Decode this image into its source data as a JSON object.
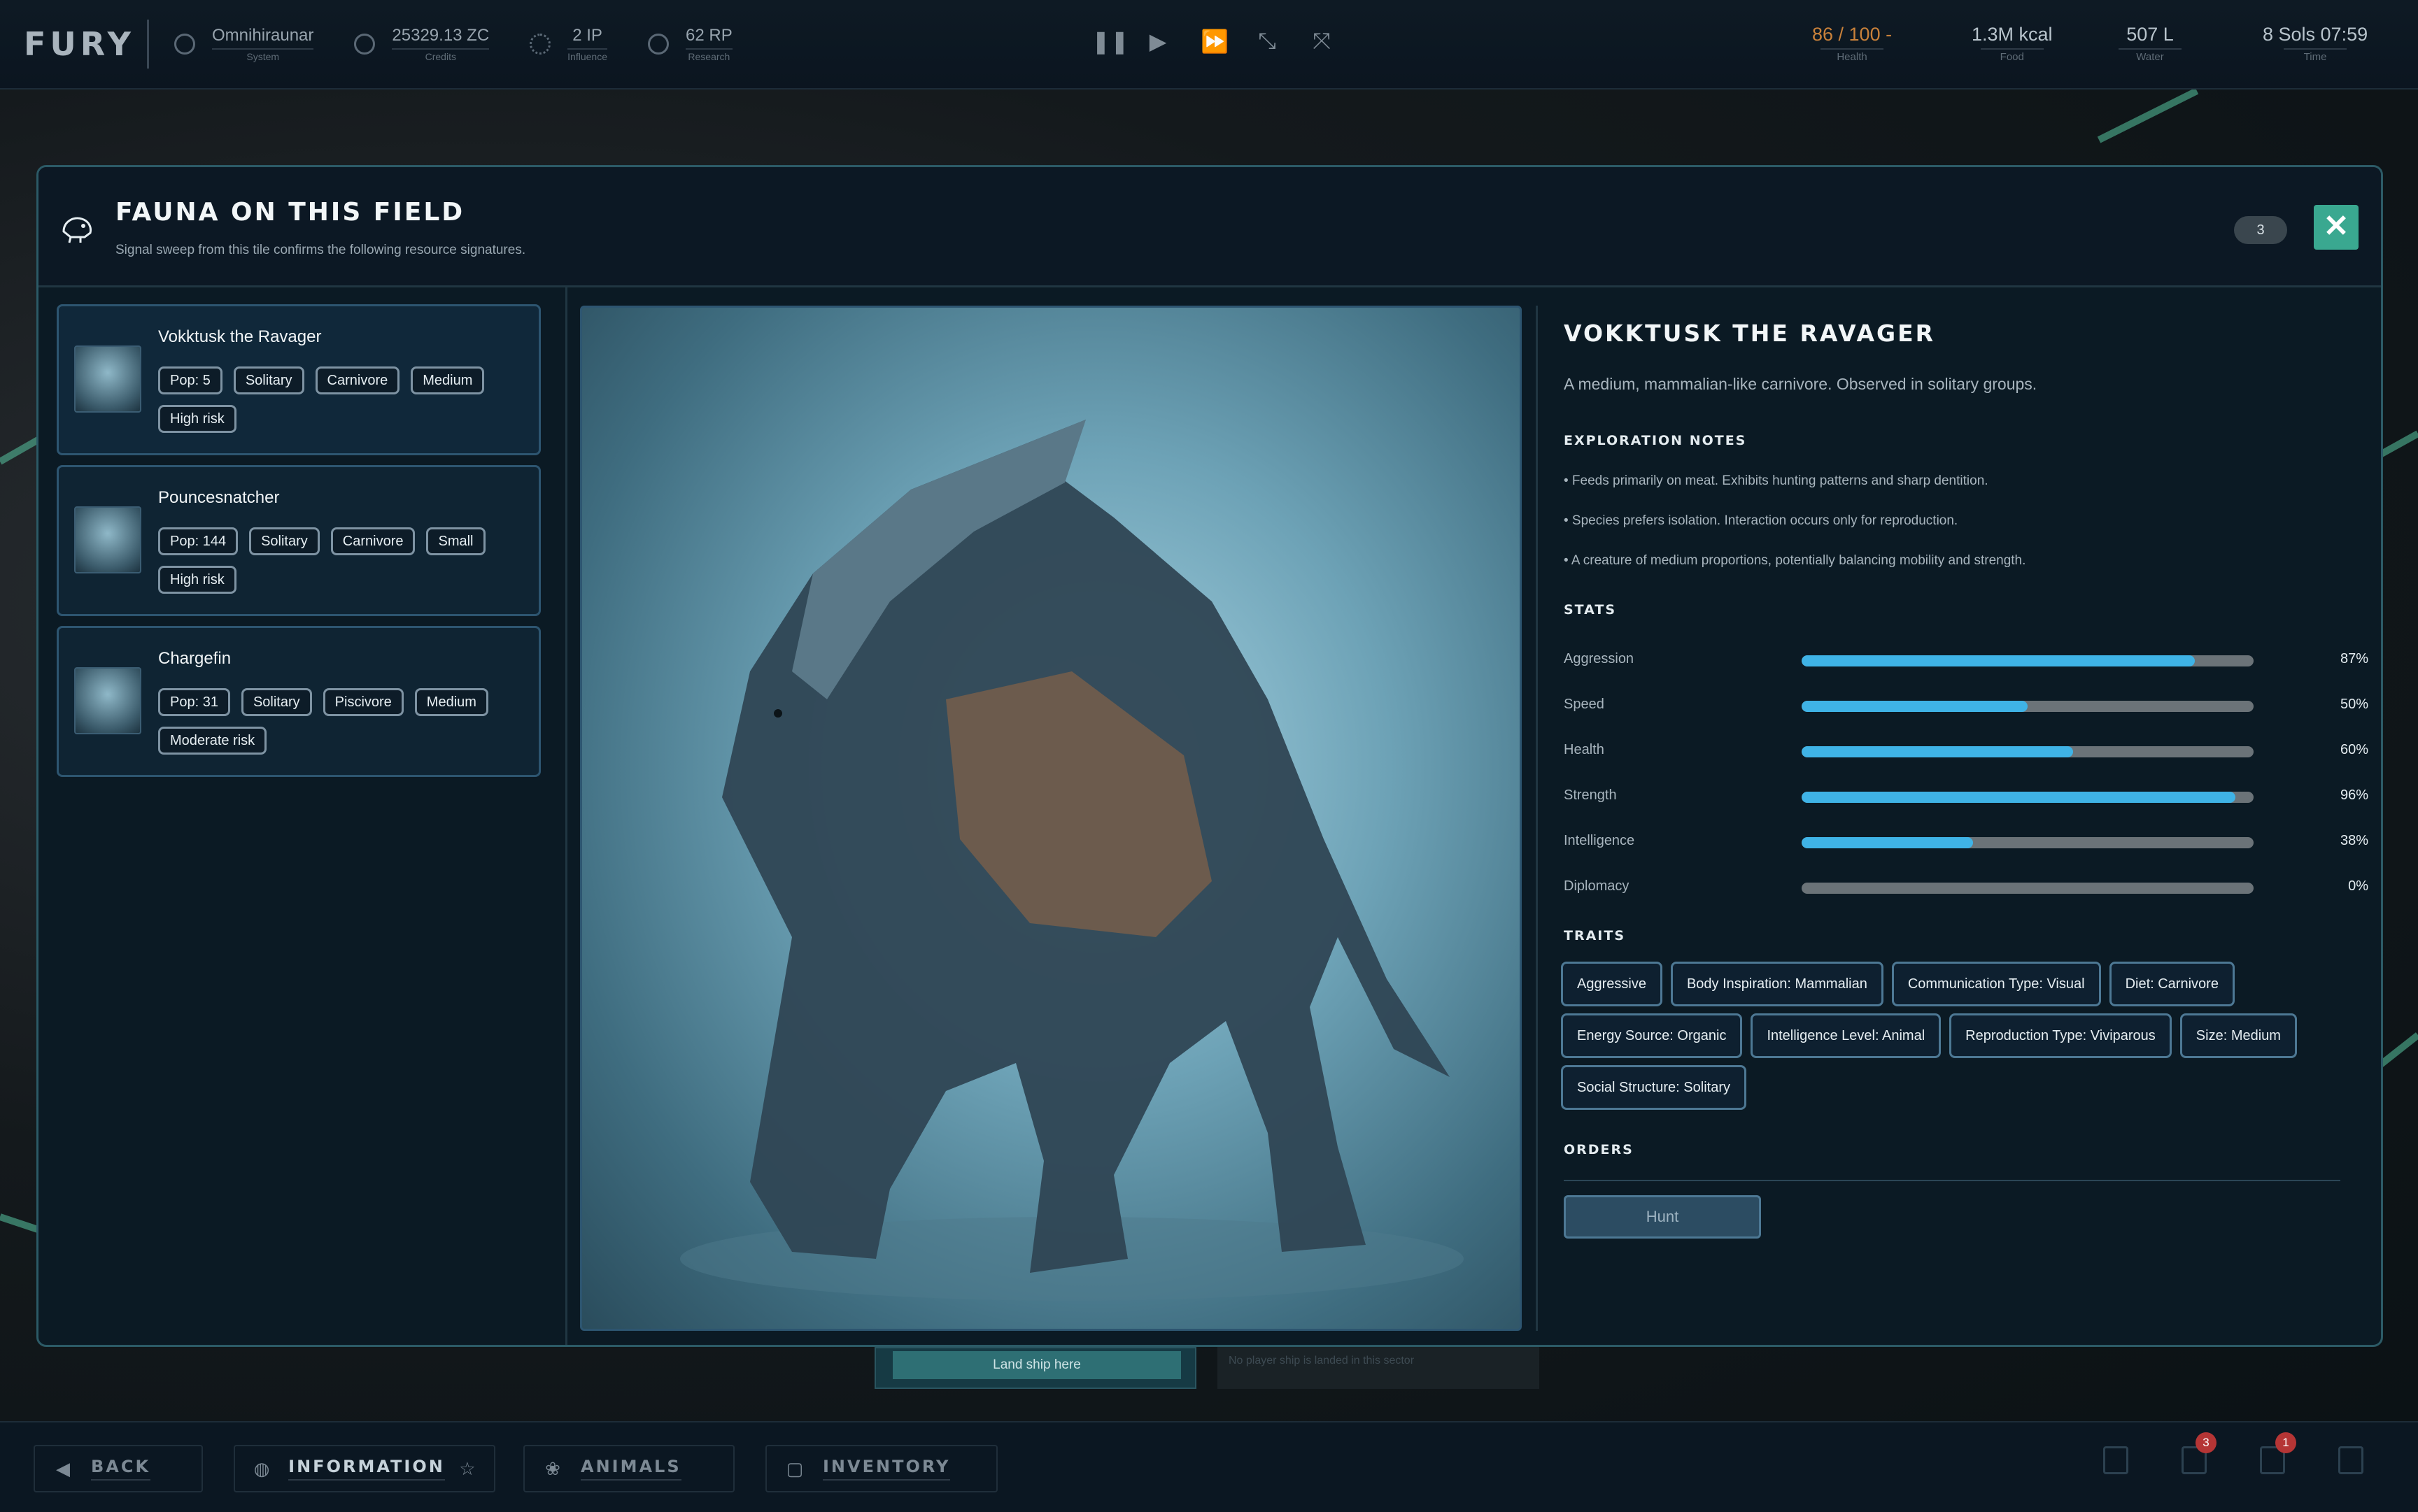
{
  "topbar": {
    "logo": "FURY",
    "resources": [
      {
        "value": "Omnihiraunar",
        "label": "System",
        "icon": "system-icon"
      },
      {
        "value": "25329.13 ZC",
        "label": "Credits",
        "icon": "credits-icon"
      },
      {
        "value": "2 IP",
        "label": "Influence",
        "icon": "influence-icon"
      },
      {
        "value": "62 RP",
        "label": "Research",
        "icon": "research-icon"
      }
    ],
    "controls": [
      "pause-icon",
      "play-icon",
      "fast-forward-icon",
      "faster-icon",
      "fastest-icon"
    ],
    "stats": {
      "health": {
        "value": "86 / 100 -",
        "label": "Health",
        "color": "#c9813a"
      },
      "food": {
        "value": "1.3M kcal",
        "label": "Food"
      },
      "water": {
        "value": "507 L",
        "label": "Water"
      },
      "time": {
        "value": "8 Sols 07:59",
        "label": "Time"
      }
    }
  },
  "panel": {
    "title": "Fauna on this field",
    "subtitle": "Signal sweep from this tile confirms the following resource signatures.",
    "count": "3",
    "close": "✕",
    "fauna": [
      {
        "name": "Vokktusk the Ravager",
        "tags": [
          "Pop: 5",
          "Solitary",
          "Carnivore",
          "Medium",
          "High risk"
        ]
      },
      {
        "name": "Pouncesnatcher",
        "tags": [
          "Pop: 144",
          "Solitary",
          "Carnivore",
          "Small",
          "High risk"
        ]
      },
      {
        "name": "Chargefin",
        "tags": [
          "Pop: 31",
          "Solitary",
          "Piscivore",
          "Medium",
          "Moderate risk"
        ]
      }
    ]
  },
  "detail": {
    "title": "Vokktusk the Ravager",
    "description": "A medium, mammalian-like carnivore. Observed in solitary groups.",
    "notes_heading": "Exploration notes",
    "notes": [
      "• Feeds primarily on meat. Exhibits hunting patterns and sharp dentition.",
      "• Species prefers isolation. Interaction occurs only for reproduction.",
      "• A creature of medium proportions, potentially balancing mobility and strength."
    ],
    "stats_heading": "Stats",
    "stats": [
      {
        "label": "Aggression",
        "value": 87,
        "display": "87%"
      },
      {
        "label": "Speed",
        "value": 50,
        "display": "50%"
      },
      {
        "label": "Health",
        "value": 60,
        "display": "60%"
      },
      {
        "label": "Strength",
        "value": 96,
        "display": "96%"
      },
      {
        "label": "Intelligence",
        "value": 38,
        "display": "38%"
      },
      {
        "label": "Diplomacy",
        "value": 0,
        "display": "0%"
      }
    ],
    "traits_heading": "Traits",
    "traits": [
      "Aggressive",
      "Body Inspiration: Mammalian",
      "Communication Type: Visual",
      "Diet: Carnivore",
      "Energy Source: Organic",
      "Intelligence Level: Animal",
      "Reproduction Type: Viviparous",
      "Size: Medium",
      "Social Structure: Solitary"
    ],
    "orders_heading": "Orders",
    "hunt_label": "Hunt"
  },
  "background": {
    "land_ship": "Land ship here",
    "no_ship": "No player ship is landed in this sector"
  },
  "bottombar": {
    "buttons": [
      {
        "label": "Back",
        "icon": "back-arrow-icon"
      },
      {
        "label": "Information",
        "icon": "globe-icon"
      },
      {
        "label": "Animals",
        "icon": "paw-icon"
      },
      {
        "label": "Inventory",
        "icon": "box-icon"
      }
    ],
    "badges": [
      "3",
      "1"
    ]
  }
}
